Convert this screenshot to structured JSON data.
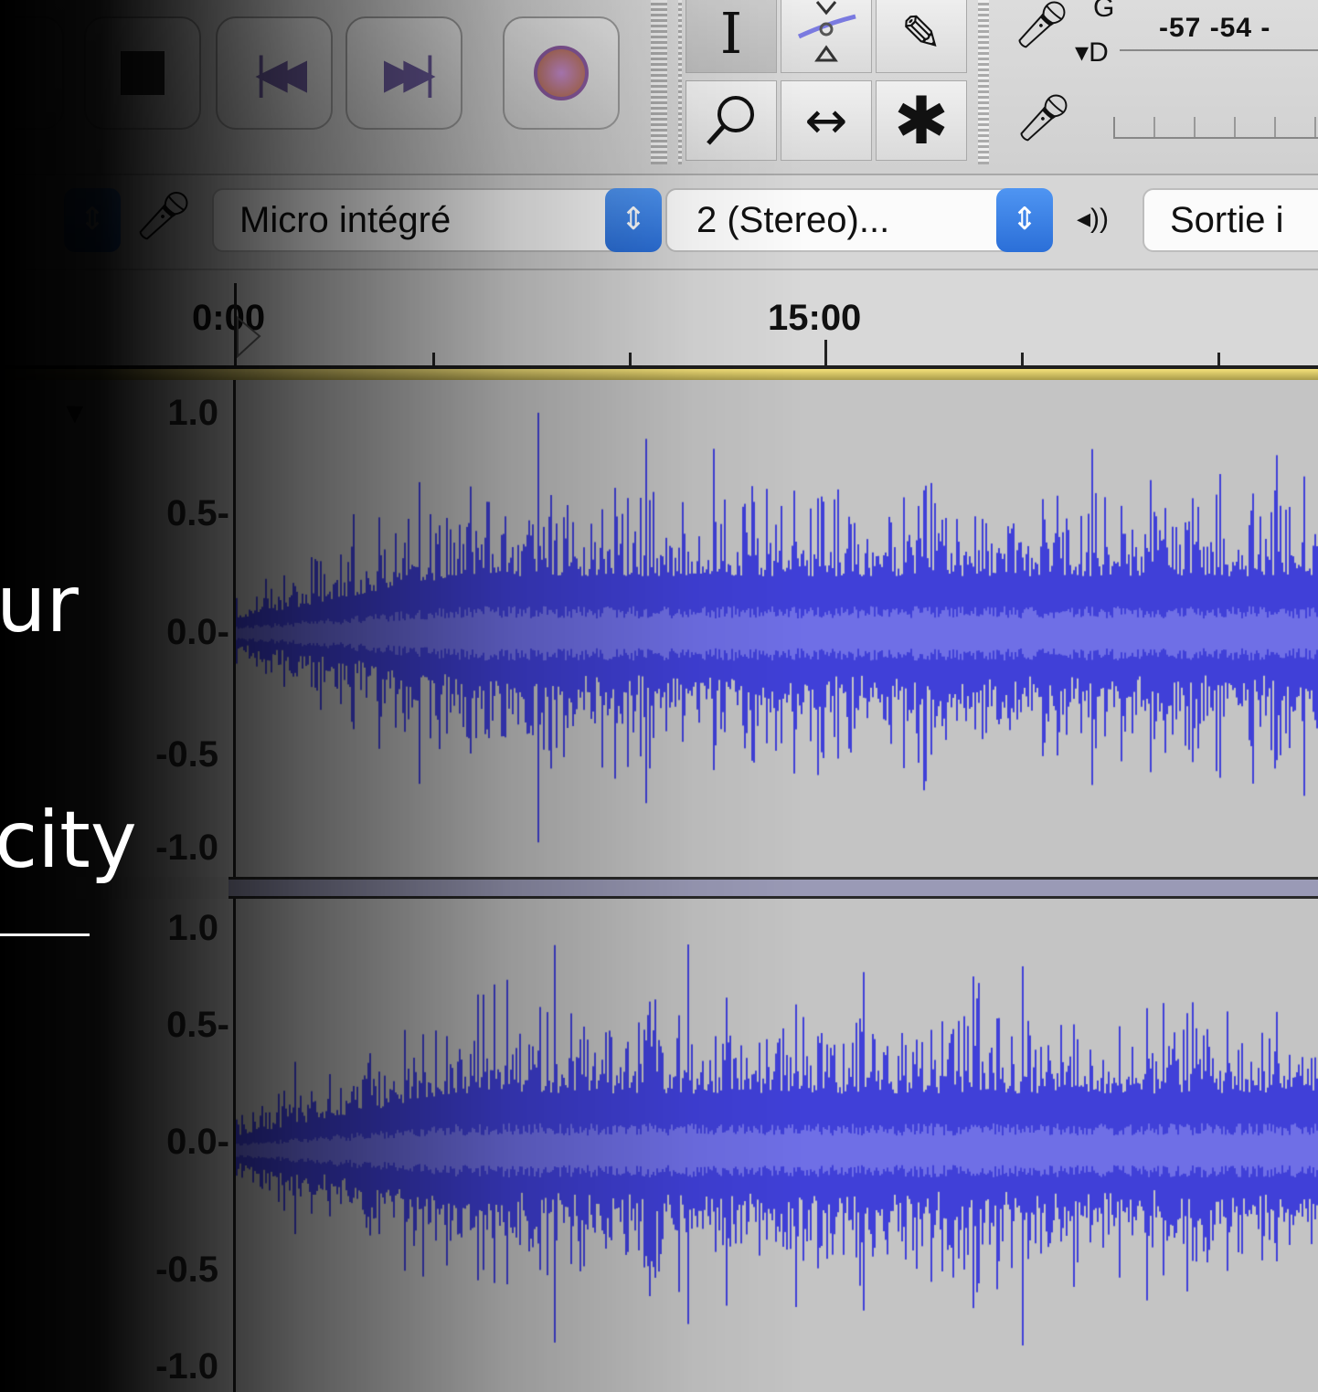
{
  "toolbar": {
    "transport": [
      "stop-button",
      "skip-start-button",
      "skip-end-button",
      "loop-button"
    ],
    "meter_scale_text": "-57 -54 -",
    "meter_channel_left": "G",
    "meter_channel_right": "D"
  },
  "device_bar": {
    "input_device": "Micro intégré",
    "channels": "2 (Stereo)...",
    "output_device": "Sortie i",
    "speaker_glyph": "◂))"
  },
  "ruler": {
    "labels": [
      "0:00",
      "15:00"
    ]
  },
  "tracks": [
    {
      "scale": [
        "1.0",
        "0.5-",
        "0.0-",
        "-0.5",
        "-1.0"
      ]
    },
    {
      "scale": [
        "1.0",
        "0.5-",
        "0.0-",
        "-0.5",
        "-1.0"
      ]
    }
  ],
  "overlay_text": {
    "line1": "ur",
    "line2": "city"
  },
  "colors": {
    "waveform": "#4040d8",
    "waveform_rms": "#6f6fe6",
    "accent_spin": "#2b6fd8"
  }
}
